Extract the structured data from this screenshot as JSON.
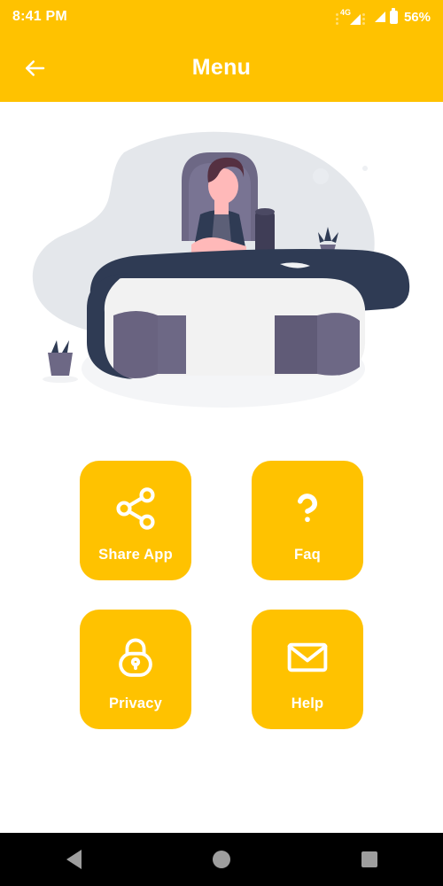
{
  "statusbar": {
    "time": "8:41 PM",
    "network_type": "4G",
    "battery_percent": "56%",
    "icons": [
      "signal-4g-icon",
      "signal-icon",
      "battery-icon"
    ]
  },
  "appbar": {
    "title": "Menu",
    "back_icon": "arrow-left-icon"
  },
  "illustration": {
    "name": "person-at-desk-illustration",
    "colors": {
      "blob": "#E4E7EB",
      "desk_top": "#2F3B54",
      "desk_edge": "#F2F2F2",
      "cabinet": "#696380",
      "skin": "#FFB9B9",
      "hair": "#553041",
      "shirt": "#575A89"
    }
  },
  "menu": {
    "items": [
      {
        "label": "Share App",
        "icon": "share-icon"
      },
      {
        "label": "Faq",
        "icon": "question-mark-icon"
      },
      {
        "label": "Privacy",
        "icon": "lock-icon"
      },
      {
        "label": "Help",
        "icon": "envelope-icon"
      }
    ]
  },
  "navbar": {
    "buttons": [
      {
        "name": "back",
        "icon": "triangle-back-icon"
      },
      {
        "name": "home",
        "icon": "circle-home-icon"
      },
      {
        "name": "recents",
        "icon": "square-recents-icon"
      }
    ]
  },
  "theme": {
    "accent": "#FFC200",
    "background": "#FFFFFF",
    "on_accent": "#FFFFFF",
    "navbar_bg": "#000000",
    "navbar_icon": "#9E9E9E"
  }
}
